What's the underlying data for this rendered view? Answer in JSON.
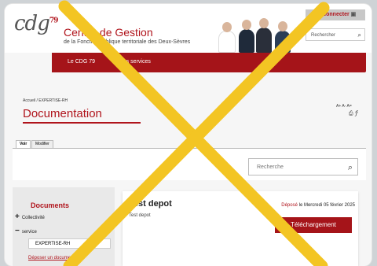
{
  "header": {
    "logo_text": "cdg",
    "logo_num": "79",
    "org_title": "Centre de Gestion",
    "org_subtitle": "de la Fonction publique territoriale des Deux-Sèvres",
    "connect_label": "Se connecter",
    "search_placeholder": "Rechercher"
  },
  "nav": {
    "items": [
      {
        "label": "Le CDG 79"
      },
      {
        "label": "Autres services"
      }
    ]
  },
  "breadcrumb": "Accueil / EXPERTISE-RH",
  "page_title": "Documentation",
  "font_tools": "A+  A-  A=",
  "tabs": [
    {
      "label": "Voir"
    },
    {
      "label": "Modifier"
    }
  ],
  "search": {
    "placeholder": "Recherche"
  },
  "sidebar": {
    "title": "Documents",
    "items": [
      {
        "symbol": "+",
        "label": "Collectivité"
      },
      {
        "symbol": "−",
        "label": "service"
      }
    ],
    "sub_item": "EXPERTISE-RH",
    "link": "Déposer un document"
  },
  "card": {
    "title": "Test depot",
    "subtitle": "Test depot",
    "posted_label": "Déposé",
    "date_text": "le Mercredi 05 février 2025",
    "download_label": "Téléchargement"
  },
  "colors": {
    "brand_red": "#a51419",
    "overlay_cross": "#f3c523"
  },
  "icons": [
    "lock-icon",
    "search-icon",
    "print-icon",
    "share-icon",
    "plus-icon",
    "minus-icon"
  ]
}
